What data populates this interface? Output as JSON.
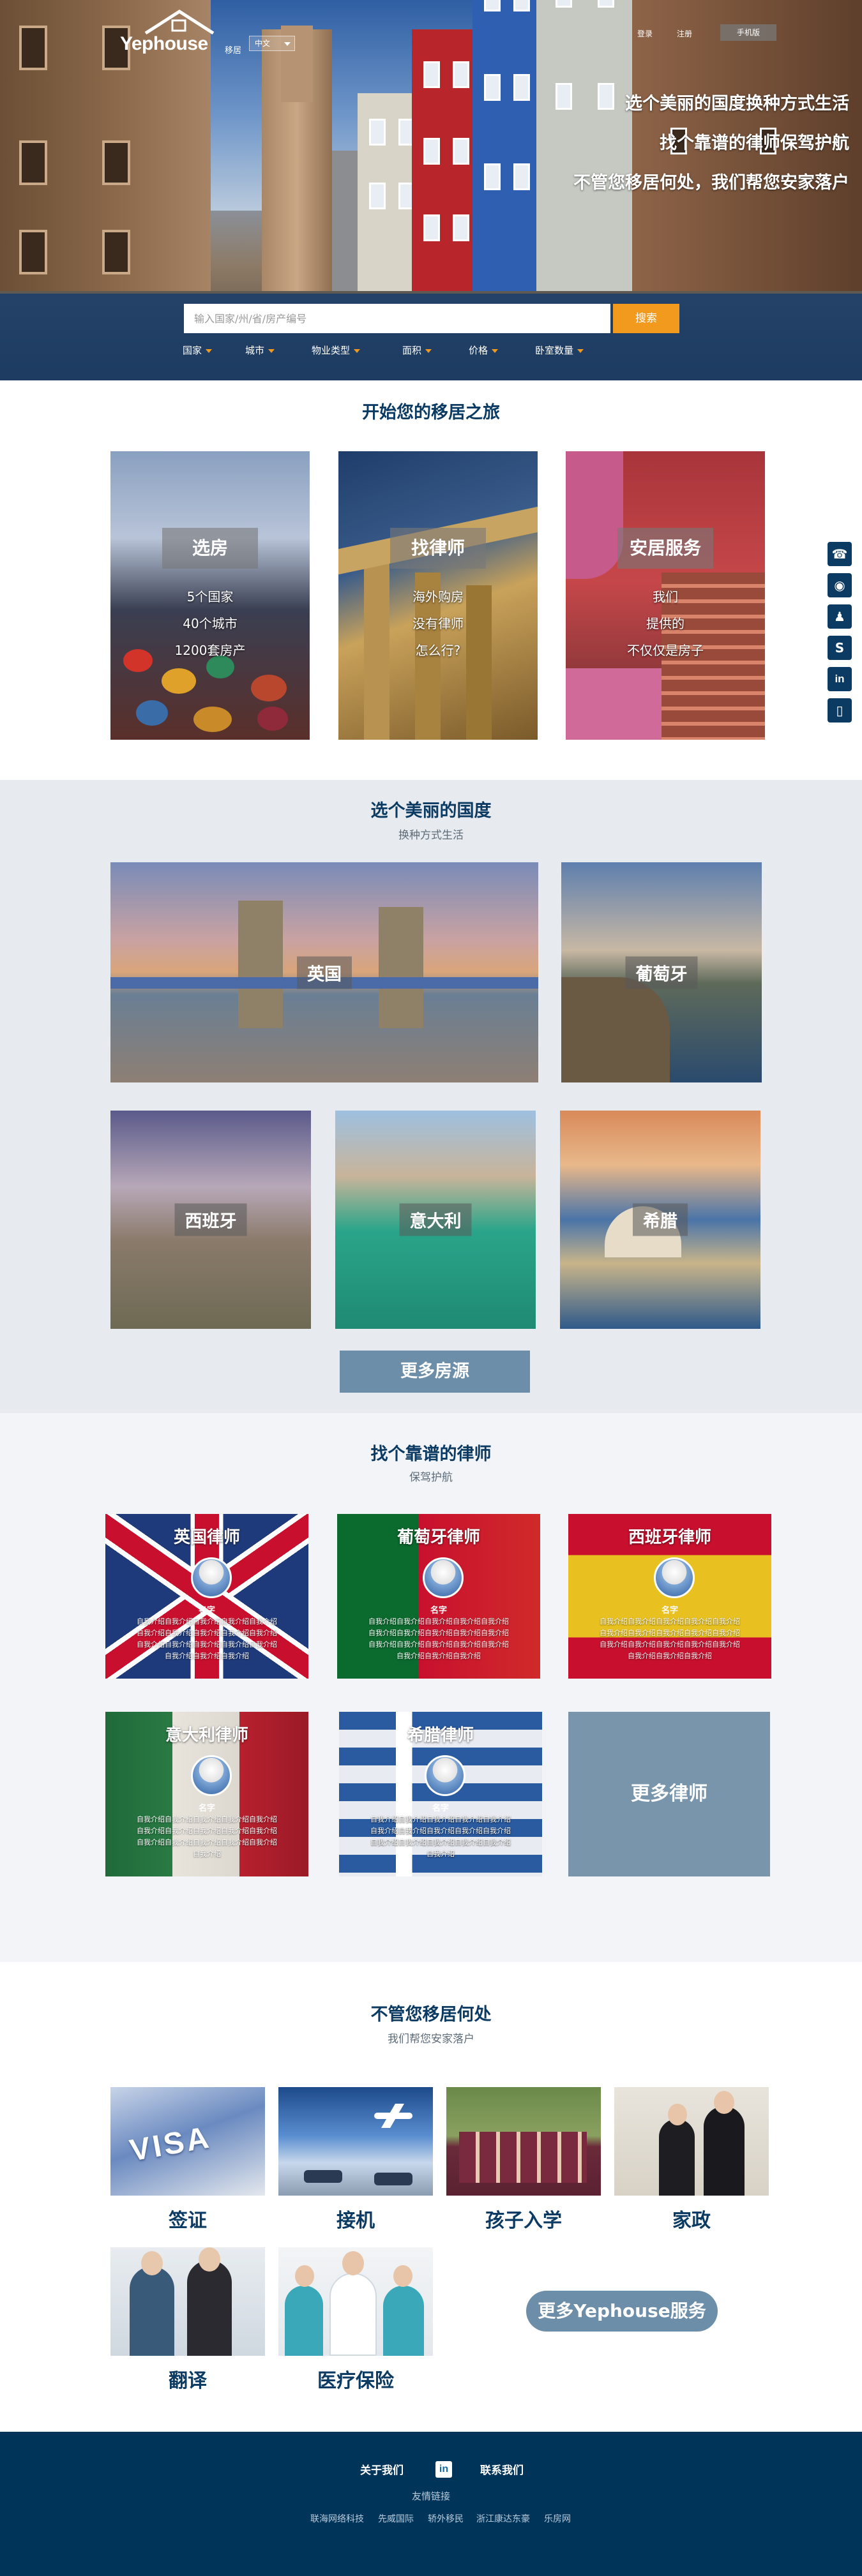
{
  "header": {
    "logo_text": "Yephouse",
    "logo_sub": "移居",
    "language": "中文",
    "top_links": [
      "登录",
      "注册"
    ],
    "mobile_label": "手机版",
    "slogans": [
      "选个美丽的国度换种方式生活",
      "找个靠谱的律师保驾护航",
      "不管您移居何处，我们帮您安家落户"
    ]
  },
  "search": {
    "placeholder": "输入国家/州/省/房产编号",
    "button": "搜索",
    "filters": [
      "国家",
      "城市",
      "物业类型",
      "面积",
      "价格",
      "卧室数量"
    ]
  },
  "journey": {
    "title": "开始您的移居之旅",
    "cards": [
      {
        "label": "选房",
        "lines": [
          "5个国家",
          "40个城市",
          "1200套房产"
        ]
      },
      {
        "label": "找律师",
        "lines": [
          "海外购房",
          "没有律师",
          "怎么行?"
        ]
      },
      {
        "label": "安居服务",
        "lines": [
          "我们",
          "提供的",
          "不仅仅是房子"
        ]
      }
    ]
  },
  "countries": {
    "title": "选个美丽的国度",
    "subtitle": "换种方式生活",
    "items": [
      "英国",
      "葡萄牙",
      "西班牙",
      "意大利",
      "希腊"
    ],
    "more_button": "更多房源"
  },
  "lawyers": {
    "title": "找个靠谱的律师",
    "subtitle": "保驾护航",
    "items": [
      {
        "title": "英国律师",
        "name": "名字",
        "desc": "自我介绍自我介绍自我介绍自我介绍自我介绍自我介绍自我介绍自我介绍自我介绍自我介绍自我介绍自我介绍自我介绍自我介绍自我介绍自我介绍自我介绍自我介绍"
      },
      {
        "title": "葡萄牙律师",
        "name": "名字",
        "desc": "自我介绍自我介绍自我介绍自我介绍自我介绍自我介绍自我介绍自我介绍自我介绍自我介绍自我介绍自我介绍自我介绍自我介绍自我介绍自我介绍自我介绍自我介绍"
      },
      {
        "title": "西班牙律师",
        "name": "名字",
        "desc": "自我介绍自我介绍自我介绍自我介绍自我介绍自我介绍自我介绍自我介绍自我介绍自我介绍自我介绍自我介绍自我介绍自我介绍自我介绍自我介绍自我介绍自我介绍"
      },
      {
        "title": "意大利律师",
        "name": "名字",
        "desc": "自我介绍自我介绍自我介绍自我介绍自我介绍自我介绍自我介绍自我介绍自我介绍自我介绍自我介绍自我介绍自我介绍自我介绍自我介绍自我介绍"
      },
      {
        "title": "希腊律师",
        "name": "名字",
        "desc": "自我介绍自我介绍自我介绍自我介绍自我介绍自我介绍自我介绍自我介绍自我介绍自我介绍自我介绍自我介绍自我介绍自我介绍自我介绍自我介绍"
      }
    ],
    "more_button": "更多律师"
  },
  "services": {
    "title": "不管您移居何处",
    "subtitle": "我们帮您安家落户",
    "items": [
      "签证",
      "接机",
      "孩子入学",
      "家政",
      "翻译",
      "医疗保险"
    ],
    "visa_text": "VISA",
    "more_button": "更多Yephouse服务"
  },
  "sidebar": {
    "icons": [
      {
        "name": "phone-icon",
        "glyph": "☎"
      },
      {
        "name": "wechat-icon",
        "glyph": "◉"
      },
      {
        "name": "qq-icon",
        "glyph": "♟"
      },
      {
        "name": "skype-icon",
        "glyph": "S"
      },
      {
        "name": "linkedin-icon",
        "glyph": "in"
      },
      {
        "name": "mobile-icon",
        "glyph": "▯"
      }
    ]
  },
  "footer": {
    "about": "关于我们",
    "linkedin": "in",
    "contact": "联系我们",
    "friend_links": "友情链接",
    "partners": [
      "联海网络科技",
      "先威国际",
      "轿外移民",
      "浙江康达东豪",
      "乐房网"
    ]
  },
  "colors": {
    "brand_navy": "#0b3a63",
    "accent_orange": "#f29a1e",
    "button_steel": "#6d8ea9",
    "footer_bg": "#003459"
  }
}
